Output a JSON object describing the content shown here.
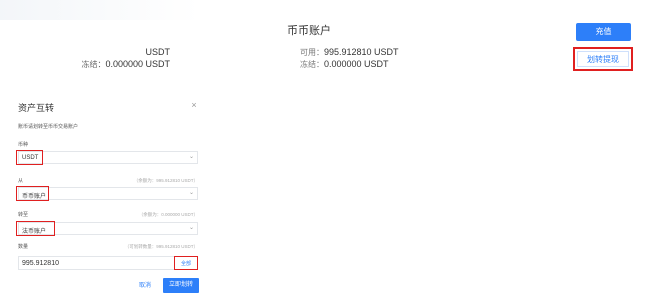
{
  "accounts": {
    "left": {
      "available_value": "USDT",
      "frozen_label": "冻结：",
      "frozen_value": "0.000000 USDT"
    },
    "coin_account": {
      "title": "币币账户",
      "available_label": "可用：",
      "available_value": "995.912810 USDT",
      "frozen_label": "冻结：",
      "frozen_value": "0.000000 USDT"
    }
  },
  "actions": {
    "recharge": "充值",
    "transfer": "划转提现"
  },
  "modal": {
    "title": "资产互转",
    "close": "×",
    "description": "账币请划转至币币交易账户",
    "fields": {
      "currency": {
        "label": "币种",
        "value": "USDT"
      },
      "from": {
        "label": "从",
        "hint": "（余额为：995.912810 USDT）",
        "value": "币币账户"
      },
      "to": {
        "label": "转至",
        "hint": "（余额为：0.000000 USDT）",
        "value": "法币账户"
      },
      "amount": {
        "label": "数量",
        "hint": "（可划转数量：995.912810 USDT）",
        "value": "995.912810",
        "all": "全部"
      }
    },
    "cancel": "取消",
    "confirm": "立即划转"
  },
  "colors": {
    "accent": "#2d7ff9",
    "highlight": "#e02020"
  }
}
